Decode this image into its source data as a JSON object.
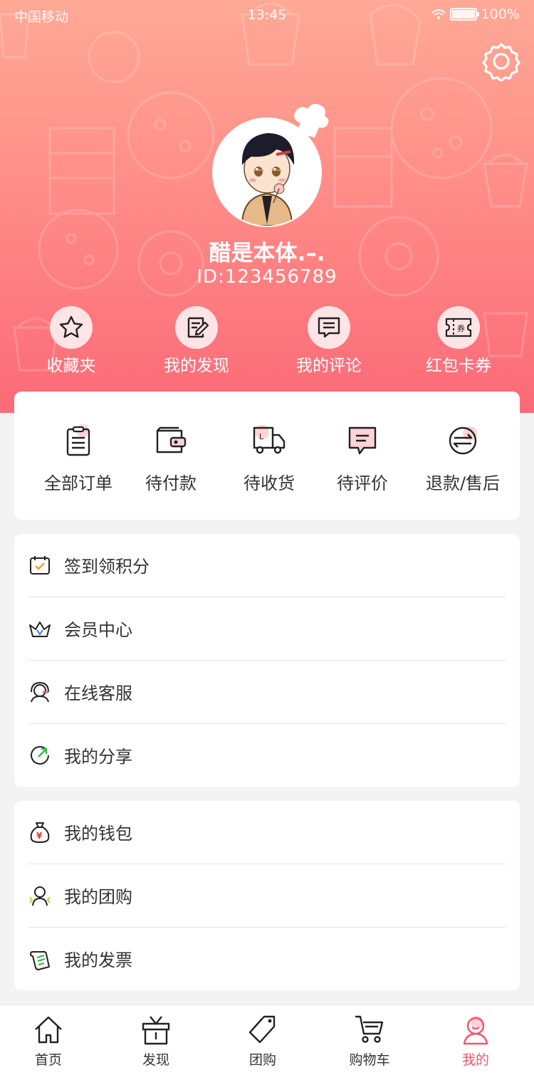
{
  "status_bar": {
    "carrier": "中国移动",
    "time": "13:45",
    "battery": "100%"
  },
  "profile": {
    "username": "醋是本体.–.",
    "user_id": "ID:123456789"
  },
  "quick_actions": [
    {
      "label": "收藏夹",
      "icon": "star-icon"
    },
    {
      "label": "我的发现",
      "icon": "edit-note-icon"
    },
    {
      "label": "我的评论",
      "icon": "comment-icon"
    },
    {
      "label": "红包卡券",
      "icon": "coupon-icon"
    }
  ],
  "orders": [
    {
      "label": "全部订单",
      "icon": "clipboard-icon"
    },
    {
      "label": "待付款",
      "icon": "wallet-icon"
    },
    {
      "label": "待收货",
      "icon": "truck-icon"
    },
    {
      "label": "待评价",
      "icon": "review-icon"
    },
    {
      "label": "退款/售后",
      "icon": "refund-icon"
    }
  ],
  "menu_group_1": [
    {
      "label": "签到领积分",
      "icon": "calendar-check-icon"
    },
    {
      "label": "会员中心",
      "icon": "crown-icon"
    },
    {
      "label": "在线客服",
      "icon": "headset-icon"
    },
    {
      "label": "我的分享",
      "icon": "share-icon"
    }
  ],
  "menu_group_2": [
    {
      "label": "我的钱包",
      "icon": "money-bag-icon"
    },
    {
      "label": "我的团购",
      "icon": "group-buy-icon"
    },
    {
      "label": "我的发票",
      "icon": "invoice-icon"
    }
  ],
  "tabbar": [
    {
      "label": "首页",
      "icon": "home-icon"
    },
    {
      "label": "发现",
      "icon": "gift-box-icon"
    },
    {
      "label": "团购",
      "icon": "tag-icon"
    },
    {
      "label": "购物车",
      "icon": "cart-icon"
    },
    {
      "label": "我的",
      "icon": "user-icon"
    }
  ],
  "colors": {
    "accent": "#f9506b",
    "header_top": "#ffa996",
    "header_bottom": "#fb6a78",
    "icon_tint": "#ffd3d8"
  }
}
